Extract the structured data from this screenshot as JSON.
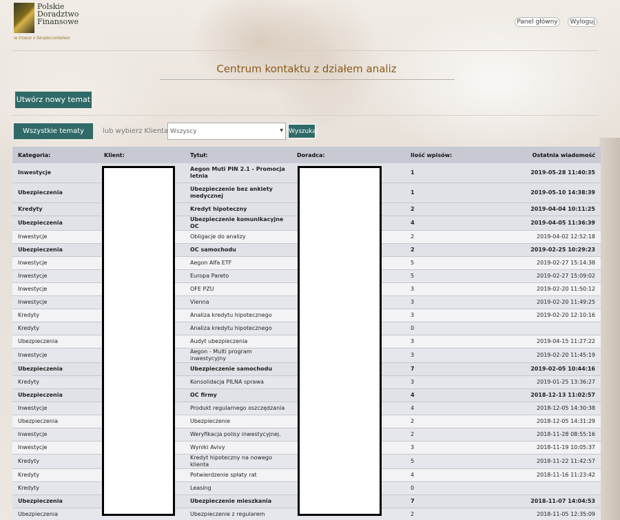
{
  "header": {
    "logo_line1": "Polskie",
    "logo_line2": "Doradztwo",
    "logo_line3": "Finansowe",
    "logo_tagline": "w trosce o bezpieczeństwo",
    "panel_button": "Panel główny",
    "logout_button": "Wyloguj"
  },
  "page_title": "Centrum kontaktu z działem analiz",
  "new_topic_button": "Utwórz nowy temat",
  "filters": {
    "all_topics_button": "Wszystkie tematy",
    "client_label": "lub wybierz Klienta:",
    "client_select_value": "Wszyscy",
    "search_button": "Wyszukaj"
  },
  "table": {
    "headers": [
      "Kategoria:",
      "Klient:",
      "Tytuł:",
      "Doradca:",
      "Ilość wpisów:",
      "Ostatnia wiadomość"
    ],
    "rows": [
      {
        "category": "Inwestycje",
        "title": "Aegon Muti PIN 2.1 - Promocja letnia",
        "count": "1",
        "last": "2019-05-28 11:40:35",
        "bold": true,
        "tall": true
      },
      {
        "category": "Ubezpieczenia",
        "title": "Ubezpieczenie bez ankiety medycznej",
        "count": "1",
        "last": "2019-05-10 14:38:39",
        "bold": true,
        "tall": true
      },
      {
        "category": "Kredyty",
        "title": "Kredyt hipoteczny",
        "count": "2",
        "last": "2019-04-04 10:11:25",
        "bold": true
      },
      {
        "category": "Ubezpieczenia",
        "title": "Ubezpieczenie komunikacyjne OC",
        "count": "4",
        "last": "2019-04-05 11:36:39",
        "bold": true
      },
      {
        "category": "Inwestycje",
        "title": "Obligacje do analizy",
        "count": "2",
        "last": "2019-04-02 12:52:18",
        "bold": false
      },
      {
        "category": "Ubezpieczenia",
        "title": "OC samochodu",
        "count": "2",
        "last": "2019-02-25 10:29:23",
        "bold": true
      },
      {
        "category": "Inwestycje",
        "title": "Aegon Alfa ETF",
        "count": "5",
        "last": "2019-02-27 15:14:38",
        "bold": false
      },
      {
        "category": "Inwestycje",
        "title": "Europa Pareto",
        "count": "5",
        "last": "2019-02-27 15:09:02",
        "bold": false
      },
      {
        "category": "Inwestycje",
        "title": "OFE PZU",
        "count": "3",
        "last": "2019-02-20 11:50:12",
        "bold": false
      },
      {
        "category": "Inwestycje",
        "title": "Vienna",
        "count": "3",
        "last": "2019-02-20 11:49:25",
        "bold": false
      },
      {
        "category": "Kredyty",
        "title": "Analiza kredytu hipotecznego",
        "count": "3",
        "last": "2019-02-20 12:10:16",
        "bold": false
      },
      {
        "category": "Kredyty",
        "title": "Analiza kredytu hipotecznego",
        "count": "0",
        "last": "",
        "bold": false
      },
      {
        "category": "Ubezpieczenia",
        "title": "Audyt ubezpieczenia",
        "count": "3",
        "last": "2019-04-15 11:27:22",
        "bold": false
      },
      {
        "category": "Inwestycje",
        "title": "Aegon - Multi program inwestycyjny",
        "count": "3",
        "last": "2019-02-20 11:45:19",
        "bold": false
      },
      {
        "category": "Ubezpieczenia",
        "title": "Ubezpieczenie samochodu",
        "count": "7",
        "last": "2019-02-05 10:44:16",
        "bold": true
      },
      {
        "category": "Kredyty",
        "title": "Konsolidacja PILNA sprawa",
        "count": "3",
        "last": "2019-01-25 13:36:27",
        "bold": false
      },
      {
        "category": "Ubezpieczenia",
        "title": "OC firmy",
        "count": "4",
        "last": "2018-12-13 11:02:57",
        "bold": true
      },
      {
        "category": "Inwestycje",
        "title": "Produkt regularnego oszczędzania",
        "count": "4",
        "last": "2018-12-05 14:30:38",
        "bold": false
      },
      {
        "category": "Ubezpieczenia",
        "title": "Ubezpieczenie",
        "count": "2",
        "last": "2018-12-05 14:31:29",
        "bold": false
      },
      {
        "category": "Inwestycje",
        "title": "Weryfikacja polisy inwestycyjnej.",
        "count": "2",
        "last": "2018-11-28 08:55:16",
        "bold": false
      },
      {
        "category": "Inwestycje",
        "title": "Wyniki Avivy",
        "count": "3",
        "last": "2018-11-19 10:05:37",
        "bold": false
      },
      {
        "category": "Kredyty",
        "title": "Kredyt hipoteczny na nowego klienta",
        "count": "5",
        "last": "2018-11-22 11:42:57",
        "bold": false
      },
      {
        "category": "Kredyty",
        "title": "Potwierdzenie spłaty rat",
        "count": "4",
        "last": "2018-11-16 11:23:42",
        "bold": false
      },
      {
        "category": "Kredyty",
        "title": "Leasing",
        "count": "0",
        "last": "",
        "bold": false
      },
      {
        "category": "Ubezpieczenia",
        "title": "Ubezpieczenie mieszkania",
        "count": "7",
        "last": "2018-11-07 14:04:53",
        "bold": true
      },
      {
        "category": "Ubezpieczenia",
        "title": "Ubezpieczenie z regularem",
        "count": "2",
        "last": "2018-11-05 12:35:09",
        "bold": false
      }
    ]
  }
}
